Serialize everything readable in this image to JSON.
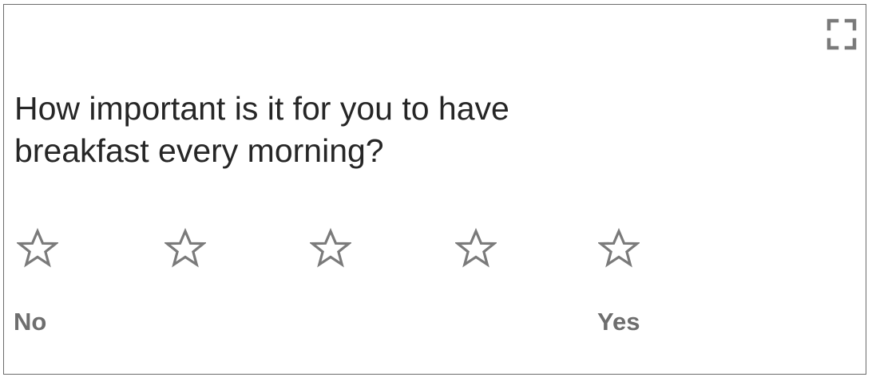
{
  "question": {
    "text": "How important is it for you to have breakfast every morning?"
  },
  "toolbar": {
    "fullscreen_icon": "fullscreen-expand-icon"
  },
  "rating": {
    "max_stars": 5,
    "selected": 0,
    "star_icon": "star-outline-icon",
    "star_color": "#7a7a7a",
    "labels": {
      "low": "No",
      "high": "Yes"
    }
  },
  "colors": {
    "border": "#6b6b6b",
    "question_text": "#262626",
    "label_text": "#6e6e6e",
    "icon": "#7a7a7a"
  }
}
